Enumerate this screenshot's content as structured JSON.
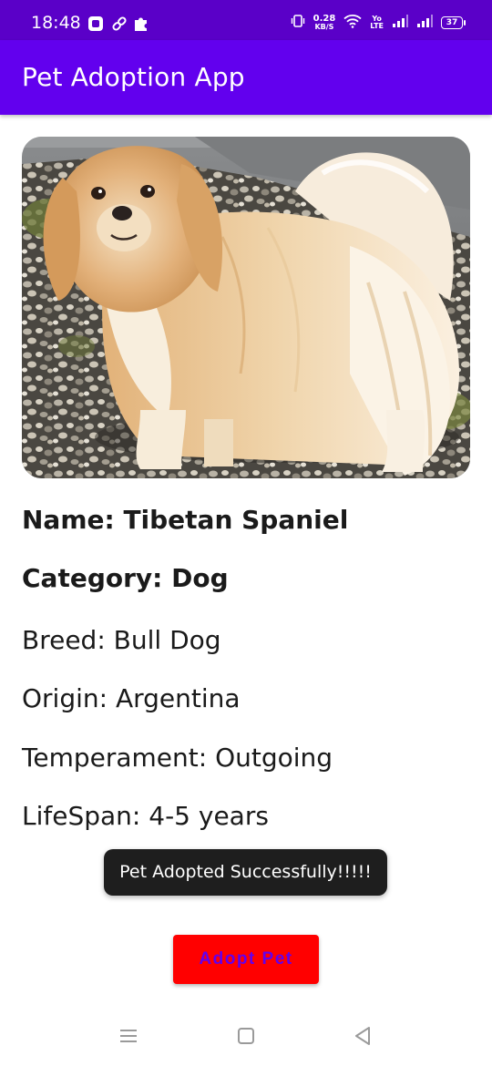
{
  "status_bar": {
    "time": "18:48",
    "net_speed_value": "0.28",
    "net_speed_unit": "KB/S",
    "volte_top": "Yo",
    "volte_bottom": "LTE",
    "battery": "37"
  },
  "app_bar": {
    "title": "Pet Adoption App"
  },
  "pet": {
    "name_line": "Name: Tibetan Spaniel",
    "category_line": "Category: Dog",
    "breed_line": "Breed: Bull Dog",
    "origin_line": "Origin: Argentina",
    "temperament_line": "Temperament: Outgoing",
    "lifespan_line": "LifeSpan: 4-5 years"
  },
  "toast": {
    "message": "Pet Adopted Successfully!!!!!"
  },
  "adopt_button": {
    "label": "Adopt Pet"
  },
  "colors": {
    "status_bar": "#5a00c8",
    "app_bar": "#6200ee",
    "button_bg": "#ff0000",
    "button_text": "#6200ee",
    "toast_bg": "#1e1e1e"
  },
  "icons": {
    "status_left": [
      "app-notification-icon",
      "link-icon",
      "puzzle-icon"
    ],
    "status_right": [
      "vibrate-icon",
      "wifi-icon",
      "signal-icon",
      "signal-icon",
      "battery-icon"
    ],
    "nav": [
      "menu-icon",
      "home-square-icon",
      "back-triangle-icon"
    ]
  }
}
